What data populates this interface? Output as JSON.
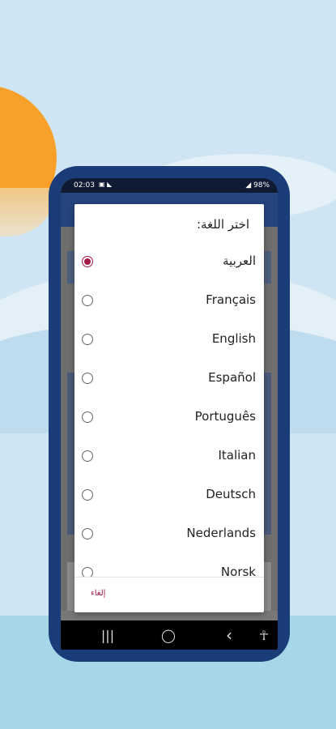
{
  "status_bar": {
    "time": "02:03",
    "icons_left": "▣ ◣",
    "right": "◢ 98%"
  },
  "dialog": {
    "title": "اختر اللغة:",
    "options": [
      {
        "label": "العربية",
        "selected": true
      },
      {
        "label": "Français",
        "selected": false
      },
      {
        "label": "English",
        "selected": false
      },
      {
        "label": "Español",
        "selected": false
      },
      {
        "label": "Português",
        "selected": false
      },
      {
        "label": "Italian",
        "selected": false
      },
      {
        "label": "Deutsch",
        "selected": false
      },
      {
        "label": "Nederlands",
        "selected": false
      },
      {
        "label": "Norsk",
        "selected": false
      }
    ],
    "cancel_label": "إلغاء"
  },
  "nav": {
    "recents": "|||",
    "home": "◯",
    "back": "‹",
    "accessibility": "☥"
  },
  "colors": {
    "accent": "#a31545",
    "phone_frame": "#1a3d7a",
    "app_bar": "#26447e"
  }
}
